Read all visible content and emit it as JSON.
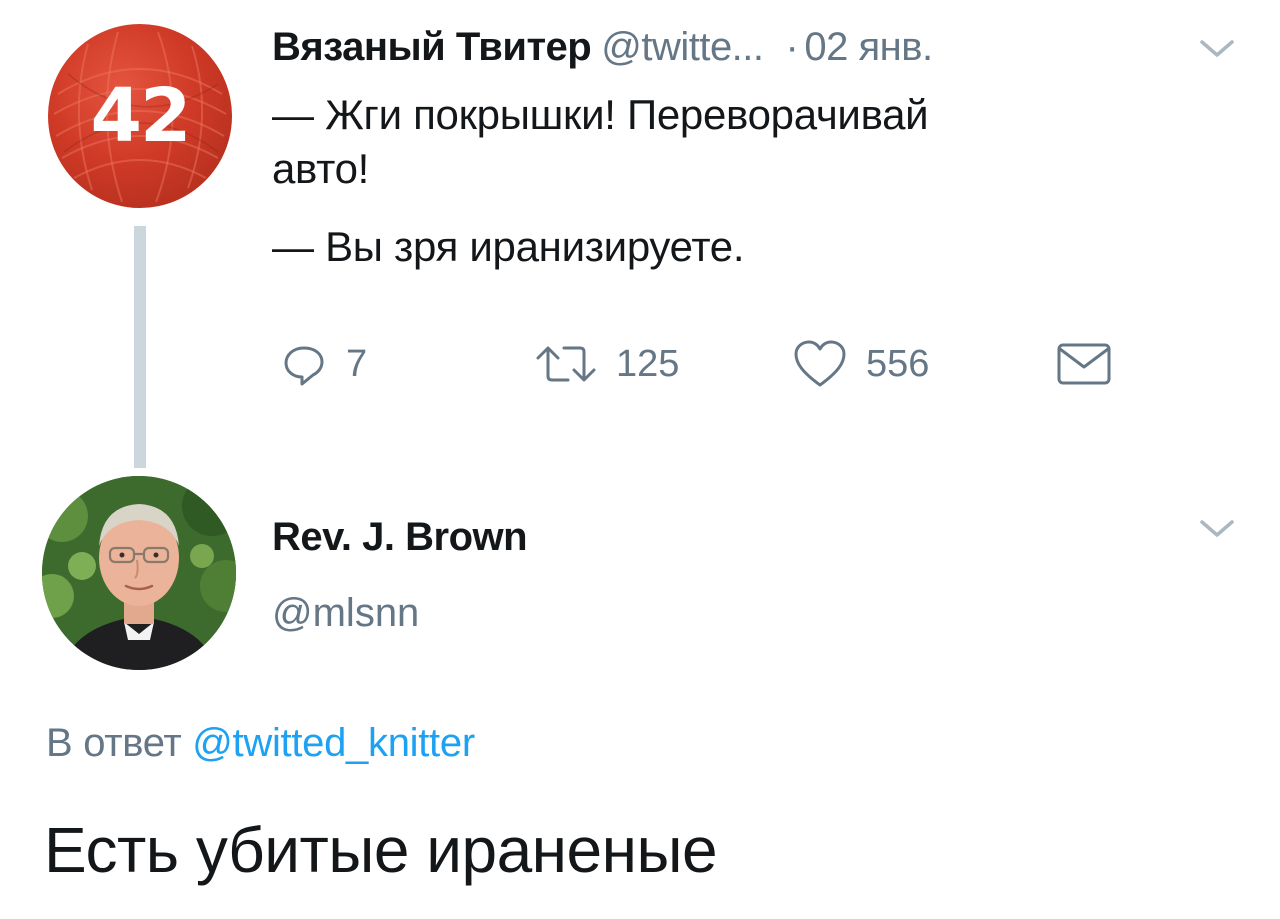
{
  "tweet1": {
    "avatar_badge": "42",
    "display_name": "Вязаный Твитер",
    "handle": "@twitte...",
    "separator": "·",
    "date": "02 янв.",
    "body_lines": [
      "— Жги покрышки! Переворачивай",
      "авто!",
      "— Вы зря иранизируете."
    ],
    "actions": {
      "reply_count": "7",
      "retweet_count": "125",
      "like_count": "556"
    },
    "icons": {
      "menu": "chevron-down-icon",
      "reply": "reply-icon",
      "retweet": "retweet-icon",
      "like": "heart-icon",
      "dm": "envelope-icon"
    }
  },
  "tweet2": {
    "display_name": "Rev. J. Brown",
    "handle": "@mlsnn",
    "reply_to_prefix": "В ответ",
    "reply_to_mention": "@twitted_knitter",
    "body": "Есть убитые ираненые"
  },
  "colors": {
    "text_primary": "#14171a",
    "text_secondary": "#657786",
    "link": "#1da1f2",
    "thread_line": "#ccd6dd",
    "avatar_red": "#cf3a26"
  }
}
